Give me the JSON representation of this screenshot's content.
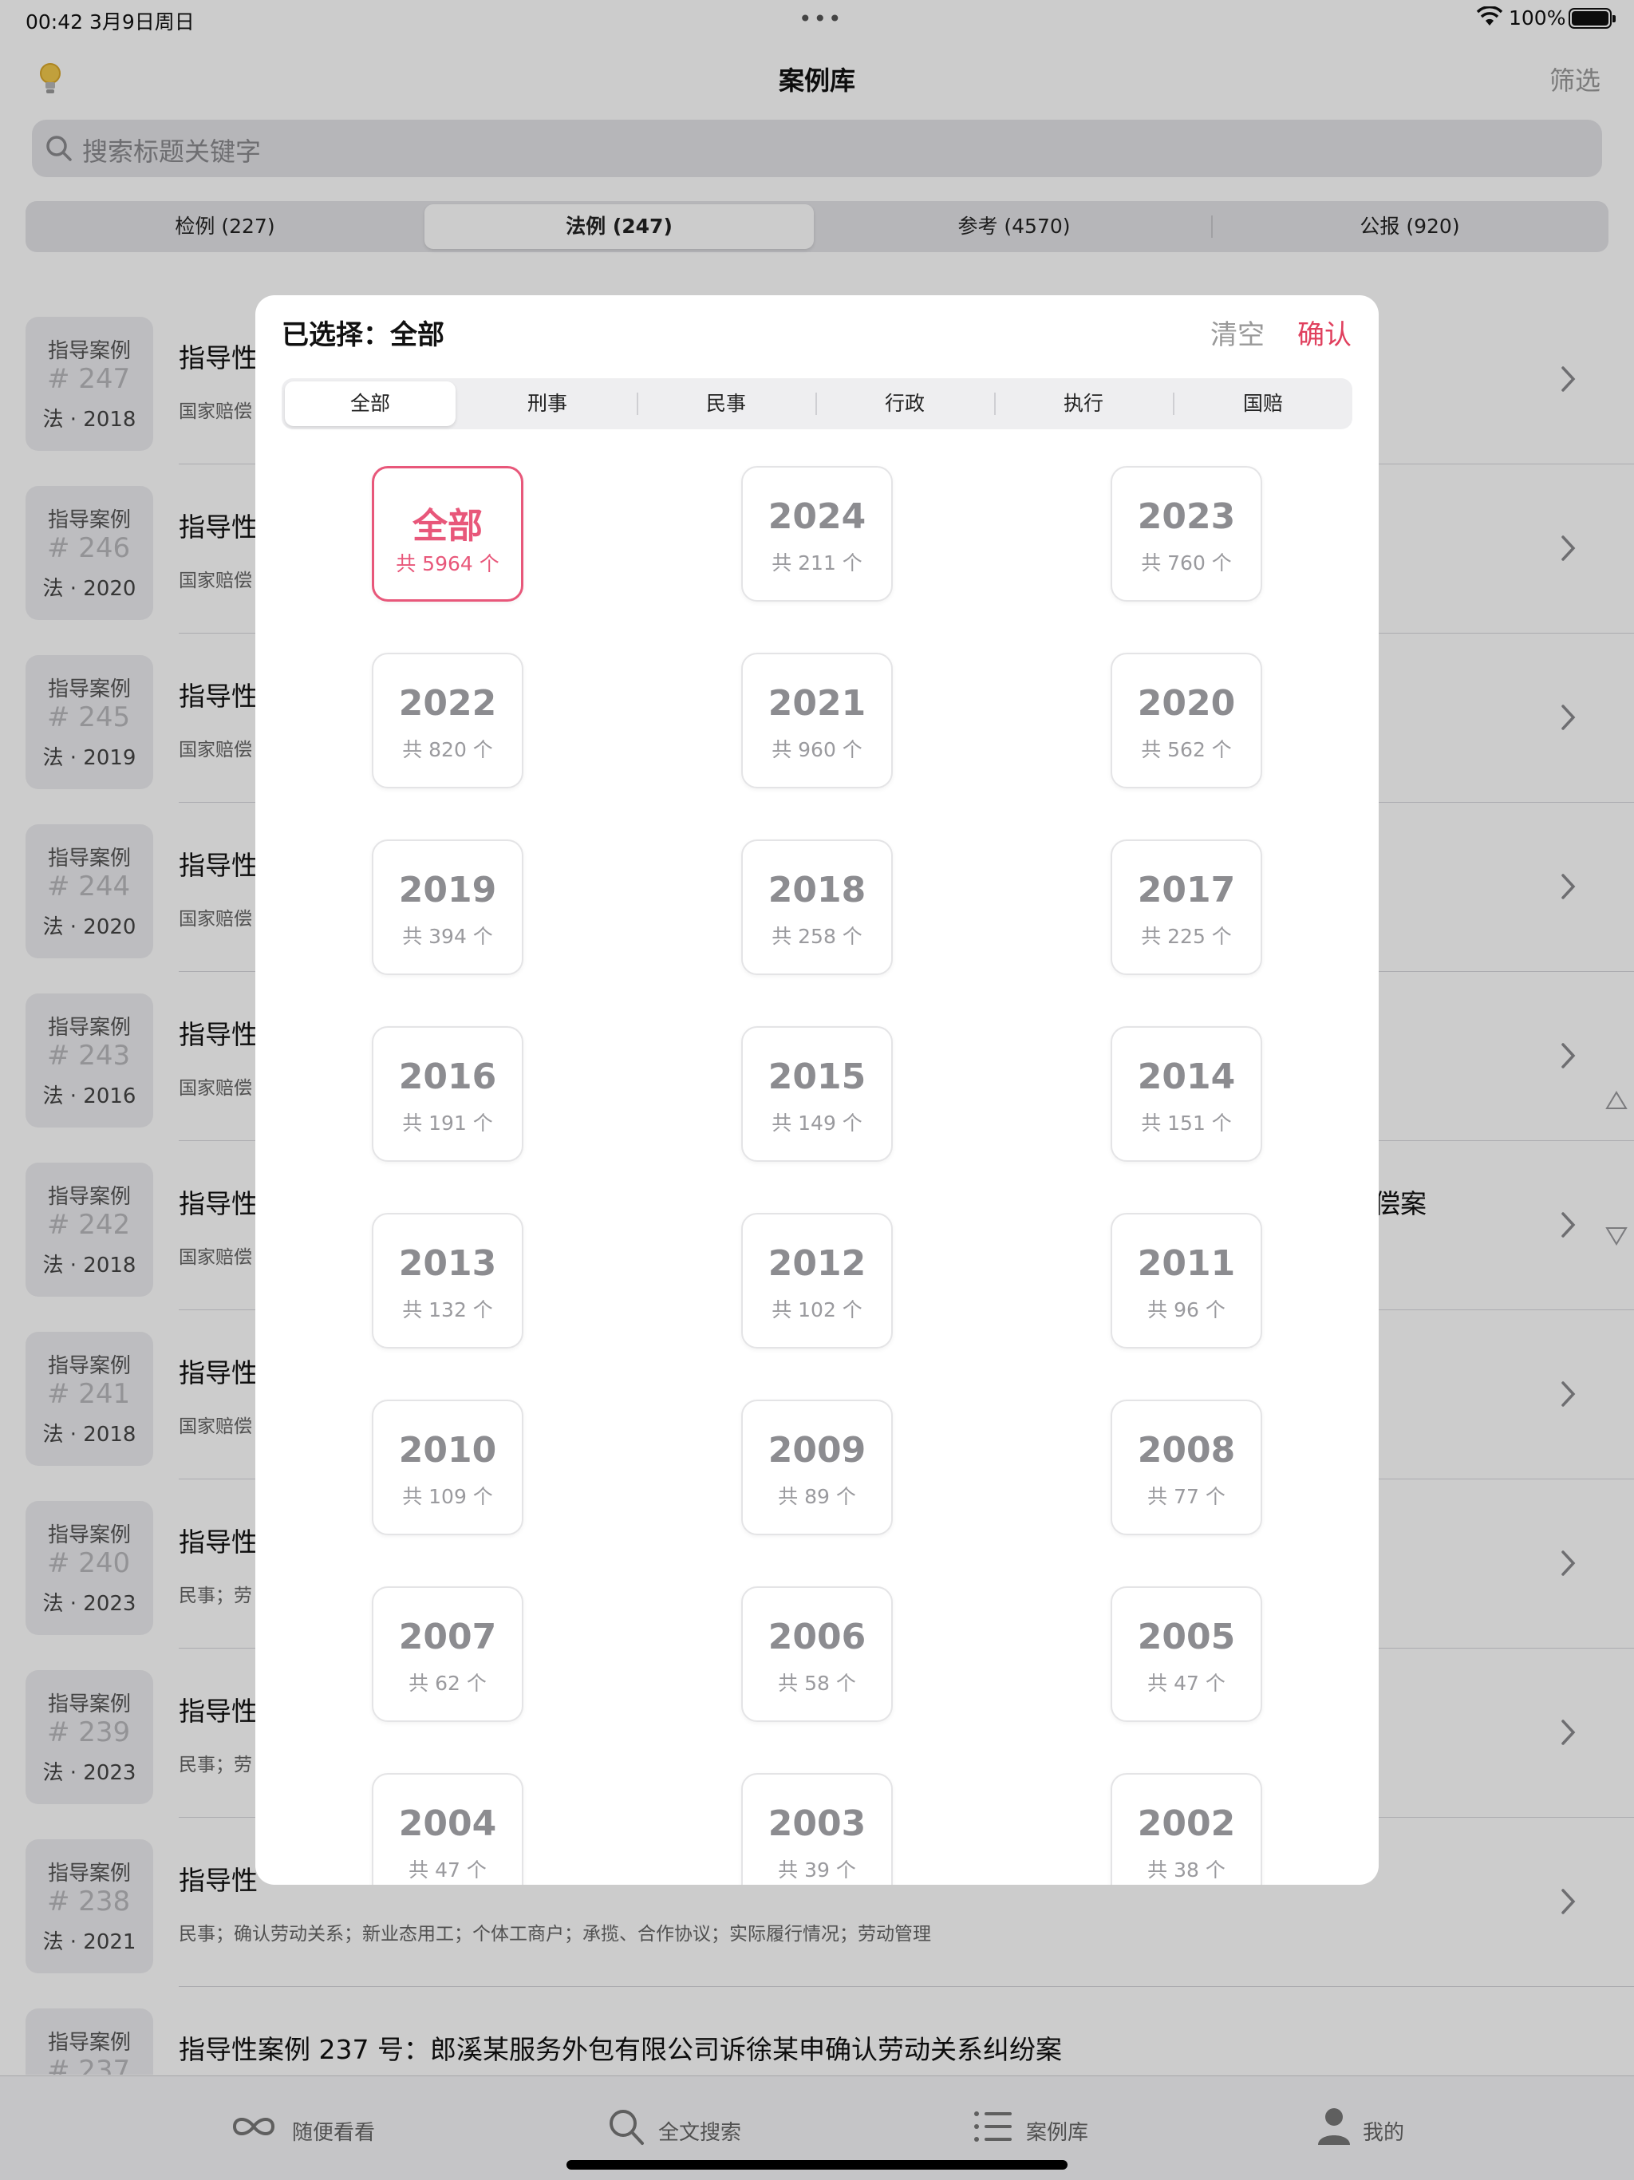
{
  "status_bar": {
    "time_date": "00:42   3月9日周日",
    "dots": "•••",
    "battery": "100%"
  },
  "nav": {
    "title": "案例库",
    "filter_label": "筛选"
  },
  "search": {
    "placeholder": "搜索标题关键字"
  },
  "tabs": [
    {
      "label": "检例 (227)"
    },
    {
      "label": "法例 (247)"
    },
    {
      "label": "参考 (4570)"
    },
    {
      "label": "公报 (920)"
    }
  ],
  "cases": [
    {
      "badge_type": "指导案例",
      "badge_num": "# 247",
      "badge_meta": "法 · 2018",
      "title": "指导性",
      "tags": "国家赔偿"
    },
    {
      "badge_type": "指导案例",
      "badge_num": "# 246",
      "badge_meta": "法 · 2020",
      "title": "指导性",
      "tags": "国家赔偿"
    },
    {
      "badge_type": "指导案例",
      "badge_num": "# 245",
      "badge_meta": "法 · 2019",
      "title": "指导性",
      "tags": "国家赔偿"
    },
    {
      "badge_type": "指导案例",
      "badge_num": "# 244",
      "badge_meta": "法 · 2020",
      "title": "指导性",
      "tags": "国家赔偿"
    },
    {
      "badge_type": "指导案例",
      "badge_num": "# 243",
      "badge_meta": "法 · 2016",
      "title": "指导性",
      "tags": "国家赔偿"
    },
    {
      "badge_type": "指导案例",
      "badge_num": "# 242",
      "badge_meta": "法 · 2018",
      "title": "指导性",
      "tags": "国家赔偿"
    },
    {
      "badge_type": "指导案例",
      "badge_num": "# 241",
      "badge_meta": "法 · 2018",
      "title": "指导性",
      "tags": "国家赔偿"
    },
    {
      "badge_type": "指导案例",
      "badge_num": "# 240",
      "badge_meta": "法 · 2023",
      "title": "指导性",
      "tags": "民事；劳"
    },
    {
      "badge_type": "指导案例",
      "badge_num": "# 239",
      "badge_meta": "法 · 2023",
      "title": "指导性",
      "tags": "民事；劳"
    },
    {
      "badge_type": "指导案例",
      "badge_num": "# 238",
      "badge_meta": "法 · 2021",
      "title": "指导性",
      "tags": "民事；确认劳动关系；新业态用工；个体工商户；承揽、合作协议；实际履行情况；劳动管理"
    },
    {
      "badge_type": "指导案例",
      "badge_num": "# 237",
      "badge_meta": "",
      "title": "指导性案例 237 号：郎溪某服务外包有限公司诉徐某申确认劳动关系纠纷案",
      "tags": ""
    }
  ],
  "row_tail_fragment": "偿案",
  "tabbar": [
    {
      "label": "随便看看",
      "icon": "infinity-icon"
    },
    {
      "label": "全文搜索",
      "icon": "search-icon"
    },
    {
      "label": "案例库",
      "icon": "list-icon"
    },
    {
      "label": "我的",
      "icon": "person-icon"
    }
  ],
  "modal": {
    "selected_text": "已选择：全部",
    "clear_label": "清空",
    "confirm_label": "确认",
    "categories": [
      "全部",
      "刑事",
      "民事",
      "行政",
      "执行",
      "国赔"
    ],
    "years": [
      {
        "year": "全部",
        "count": "共 5964 个",
        "selected": true
      },
      {
        "year": "2024",
        "count": "共 211 个"
      },
      {
        "year": "2023",
        "count": "共 760 个"
      },
      {
        "year": "2022",
        "count": "共 820 个"
      },
      {
        "year": "2021",
        "count": "共 960 个"
      },
      {
        "year": "2020",
        "count": "共 562 个"
      },
      {
        "year": "2019",
        "count": "共 394 个"
      },
      {
        "year": "2018",
        "count": "共 258 个"
      },
      {
        "year": "2017",
        "count": "共 225 个"
      },
      {
        "year": "2016",
        "count": "共 191 个"
      },
      {
        "year": "2015",
        "count": "共 149 个"
      },
      {
        "year": "2014",
        "count": "共 151 个"
      },
      {
        "year": "2013",
        "count": "共 132 个"
      },
      {
        "year": "2012",
        "count": "共 102 个"
      },
      {
        "year": "2011",
        "count": "共 96 个"
      },
      {
        "year": "2010",
        "count": "共 109 个"
      },
      {
        "year": "2009",
        "count": "共 89 个"
      },
      {
        "year": "2008",
        "count": "共 77 个"
      },
      {
        "year": "2007",
        "count": "共 62 个"
      },
      {
        "year": "2006",
        "count": "共 58 个"
      },
      {
        "year": "2005",
        "count": "共 47 个"
      },
      {
        "year": "2004",
        "count": "共 47 个"
      },
      {
        "year": "2003",
        "count": "共 39 个"
      },
      {
        "year": "2002",
        "count": "共 38 个"
      }
    ]
  },
  "colors": {
    "accent": "#e0405e",
    "selected_card": "#e8577a",
    "segment_bg": "#e4e4e8"
  }
}
